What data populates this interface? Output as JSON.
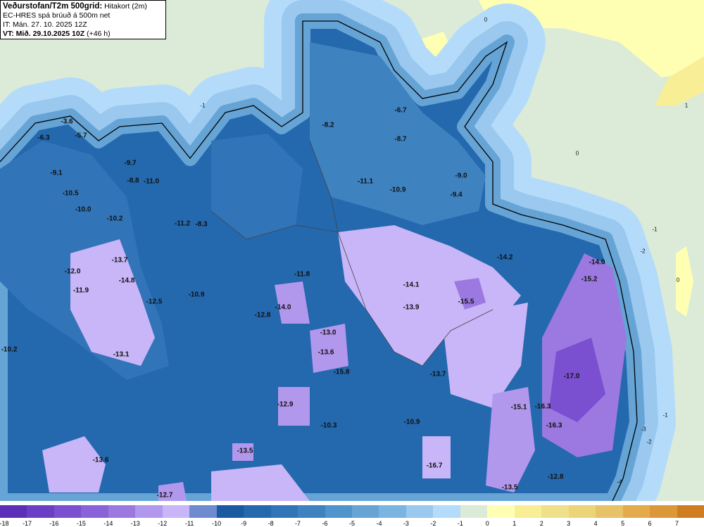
{
  "header": {
    "title_bold": "Veðurstofan/T2m 500grid:",
    "title_rest": "Hitakort (2m)",
    "model": "EC-HRES spá brúuð á 500m net",
    "issue_time": "IT: Mán. 27. 10. 2025 12Z",
    "valid_bold": "VT: Mið. 29.10.2025 10Z",
    "valid_rest": "(+46 h)"
  },
  "labels": [
    "-3.6",
    "-5.7",
    "-6.3",
    "-9.1",
    "-10.5",
    "-10.0",
    "-10.2",
    "-12.0",
    "-13.7",
    "-14.8",
    "-11.9",
    "-12.5",
    "-13.1",
    "-10.2",
    "-9.7",
    "-8.8",
    "-11.0",
    "-11.2",
    "-8.3",
    "-10.9",
    "-8.2",
    "-6.7",
    "-8.7",
    "-11.1",
    "-10.9",
    "-9.0",
    "-9.4",
    "-11.8",
    "-14.0",
    "-12.8",
    "-13.0",
    "-13.6",
    "-15.8",
    "-14.1",
    "-13.9",
    "-15.5",
    "-14.2",
    "-13.7",
    "-12.9",
    "-10.3",
    "-10.9",
    "-13.5",
    "-13.6",
    "-12.7",
    "-16.7",
    "-13.5",
    "-12.8",
    "-15.1",
    "-16.3",
    "-16.3",
    "-17.0",
    "-14.0",
    "-15.2"
  ],
  "sea_labels": [
    "0",
    "1",
    "0",
    "-1",
    "-2",
    "-1",
    "0",
    "-1",
    "-2",
    "-3",
    "-4"
  ],
  "colorbar": {
    "ticks": [
      "-18",
      "-17",
      "-16",
      "-15",
      "-14",
      "-13",
      "-12",
      "-11",
      "-10",
      "-9",
      "-8",
      "-7",
      "-6",
      "-5",
      "-4",
      "-3",
      "-2",
      "-1",
      "0",
      "1",
      "2",
      "3",
      "4",
      "5",
      "6",
      "7"
    ],
    "colors": [
      "#5b2fb8",
      "#6a3fc6",
      "#7a4fd0",
      "#8a63d9",
      "#9b79e0",
      "#b298ec",
      "#c8b6f8",
      "#6e8bd0",
      "#1a5aa0",
      "#2468ae",
      "#3274b8",
      "#3e82c0",
      "#5094cc",
      "#66a4d6",
      "#7ab4e0",
      "#9ac8ee",
      "#b4dcfa",
      "#dcebd8",
      "#ffffb4",
      "#f8ee96",
      "#f0e08a",
      "#ecd478",
      "#e8c268",
      "#e4aa4c",
      "#dc9838",
      "#d07c20"
    ]
  }
}
